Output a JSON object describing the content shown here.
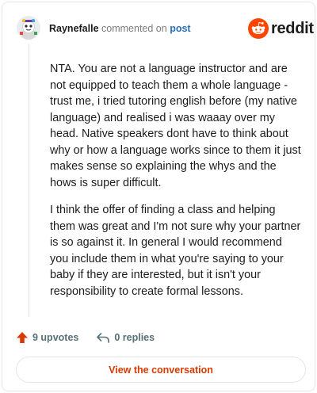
{
  "header": {
    "username": "Raynefalle",
    "commented_text": "commented on",
    "post_link": "post",
    "brand": "reddit"
  },
  "comment": {
    "paragraphs": [
      "NTA. You are not a language instructor and are not equipped to teach them a whole language - trust me, i tried tutoring english before (my native language) and realised i was waaay over my head. Native speakers dont have to think about why or how a language works since to them it just makes sense so explaining the whys and the hows is super difficult.",
      "I think the offer of finding a class and helping them was great and I'm not sure why your partner is so against it. In general I would recommend you include them in what you're saying to your baby if they are interested, but it isn't your responsibility to create formal lessons."
    ]
  },
  "actions": {
    "upvotes": "9 upvotes",
    "replies": "0 replies"
  },
  "view_button": "View the conversation",
  "colors": {
    "brand_orange": "#ff4500",
    "upvote_red": "#d93a00",
    "link_blue": "#2a6fb8",
    "muted": "#576f76"
  }
}
